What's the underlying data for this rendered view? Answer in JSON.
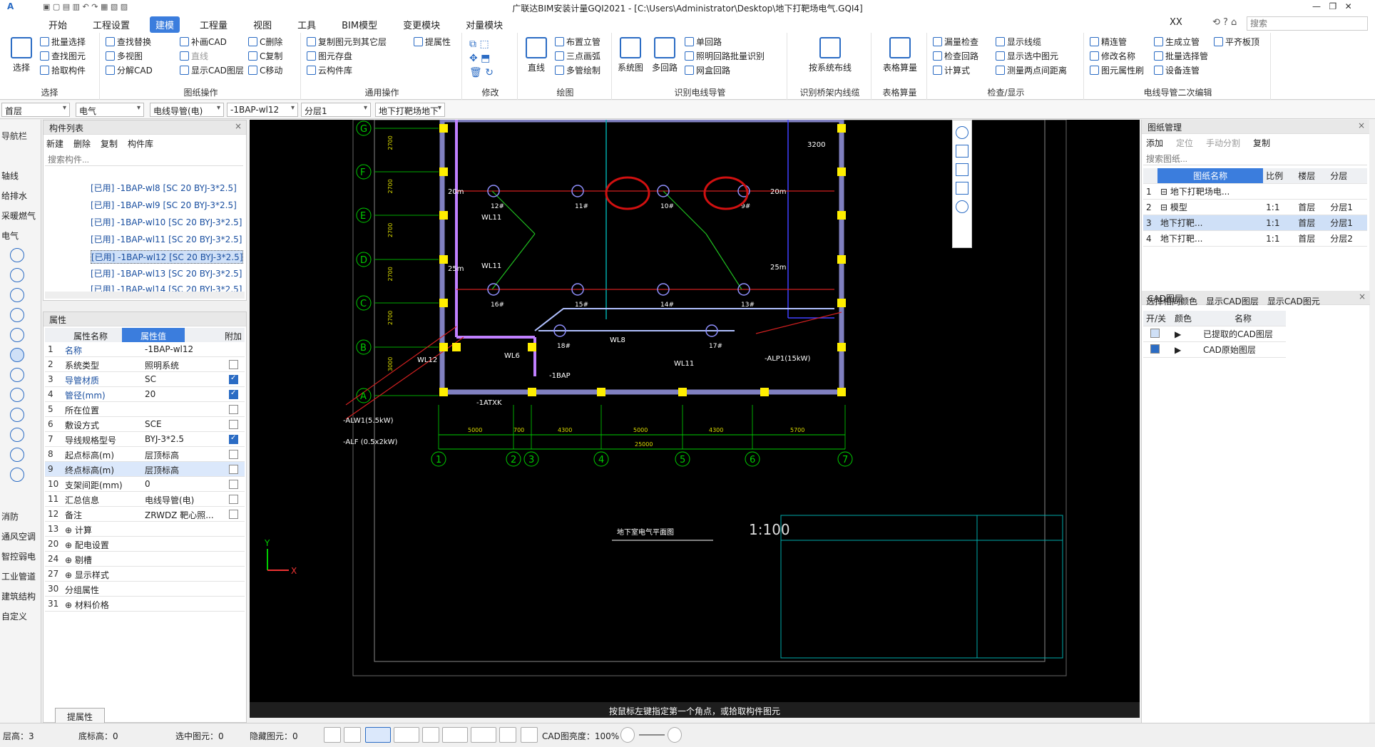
{
  "window": {
    "title": "广联达BIM安装计量GQI2021 - [C:\\Users\\Administrator\\Desktop\\地下打靶场电气.GQI4]",
    "user": "XX",
    "search_placeholder": "搜索"
  },
  "tabs": [
    "开始",
    "工程设置",
    "建模",
    "工程量",
    "视图",
    "工具",
    "BIM模型",
    "变更模块",
    "对量模块"
  ],
  "ribbon": {
    "select": {
      "big": "选择",
      "items": [
        "批量选择",
        "查找图元",
        "拾取构件"
      ],
      "label": "选择"
    },
    "drawing_ops": {
      "items": [
        "查找替换",
        "补画CAD",
        "C删除",
        "多视图",
        "直线",
        "C复制",
        "分解CAD",
        "显示CAD图层",
        "C移动"
      ],
      "label": "图纸操作"
    },
    "general_ops": {
      "items": [
        "复制图元到其它层",
        "提属性",
        "图元存盘",
        "云构件库"
      ],
      "label": "通用操作"
    },
    "modify": {
      "label": "修改"
    },
    "draw": {
      "big": "直线",
      "items": [
        "布置立管",
        "三点画弧",
        "多管绘制"
      ],
      "label": "绘图"
    },
    "recognize_pipe": {
      "big": [
        "系统图",
        "多回路"
      ],
      "items": [
        "单回路",
        "照明回路批量识别",
        "网盒回路"
      ],
      "label": "识别电线导管"
    },
    "recognize_bridge": {
      "big": "按系统布线",
      "label": "识别桥架内线缆"
    },
    "table_calc": {
      "big": "表格算量",
      "label": "表格算量"
    },
    "check": {
      "items": [
        "漏量检查",
        "显示线缆",
        "检查回路",
        "显示选中图元",
        "计算式",
        "测量两点间距离"
      ],
      "label": "检查/显示"
    },
    "secondary_edit": {
      "items": [
        "精连管",
        "生成立管",
        "平齐板顶",
        "修改名称",
        "批量选择管",
        "图元属性刷",
        "设备连管"
      ],
      "label": "电线导管二次编辑"
    }
  },
  "filters": [
    "首层",
    "电气",
    "电线导管(电)",
    "-1BAP-wl12",
    "分层1",
    "地下打靶场地下"
  ],
  "navbar": {
    "title": "导航栏",
    "items": [
      "轴线",
      "给排水",
      "采暖燃气",
      "电气",
      "消防",
      "通风空调",
      "智控弱电",
      "工业管道",
      "建筑结构",
      "自定义"
    ]
  },
  "component_list": {
    "title": "构件列表",
    "toolbar": [
      "新建",
      "删除",
      "复制",
      "构件库"
    ],
    "search_placeholder": "搜索构件...",
    "items": [
      "[已用] -1BAP-wl8 [SC 20 BYJ-3*2.5]",
      "[已用] -1BAP-wl9 [SC 20 BYJ-3*2.5]",
      "[已用] -1BAP-wl10 [SC 20 BYJ-3*2.5]",
      "[已用] -1BAP-wl11 [SC 20 BYJ-3*2.5]",
      "[已用] -1BAP-wl12 [SC 20 BYJ-3*2.5]",
      "[已用] -1BAP-wl13 [SC 20 BYJ-3*2.5]",
      "[已用] -1BAP-wl14 [SC 20 BYJ-3*2.5]"
    ],
    "selected_index": 4
  },
  "properties": {
    "title": "属性",
    "headers": [
      "属性名称",
      "属性值",
      "附加"
    ],
    "rows": [
      {
        "n": "1",
        "k": "名称",
        "v": "-1BAP-wl12",
        "c": null
      },
      {
        "n": "2",
        "k": "系统类型",
        "v": "照明系统",
        "c": false
      },
      {
        "n": "3",
        "k": "导管材质",
        "v": "SC",
        "c": true
      },
      {
        "n": "4",
        "k": "管径(mm)",
        "v": "20",
        "c": true
      },
      {
        "n": "5",
        "k": "所在位置",
        "v": "",
        "c": false
      },
      {
        "n": "6",
        "k": "敷设方式",
        "v": "SCE",
        "c": false
      },
      {
        "n": "7",
        "k": "导线规格型号",
        "v": "BYJ-3*2.5",
        "c": true
      },
      {
        "n": "8",
        "k": "起点标高(m)",
        "v": "层顶标高",
        "c": false
      },
      {
        "n": "9",
        "k": "终点标高(m)",
        "v": "层顶标高",
        "c": false
      },
      {
        "n": "10",
        "k": "支架间距(mm)",
        "v": "0",
        "c": false
      },
      {
        "n": "11",
        "k": "汇总信息",
        "v": "电线导管(电)",
        "c": false
      },
      {
        "n": "12",
        "k": "备注",
        "v": "ZRWDZ 靶心照...",
        "c": false
      },
      {
        "n": "13",
        "k": "⊕ 计算",
        "v": "",
        "c": null
      },
      {
        "n": "20",
        "k": "⊕ 配电设置",
        "v": "",
        "c": null
      },
      {
        "n": "24",
        "k": "⊕ 剔槽",
        "v": "",
        "c": null
      },
      {
        "n": "27",
        "k": "⊕ 显示样式",
        "v": "",
        "c": null
      },
      {
        "n": "30",
        "k": "分组属性",
        "v": "",
        "c": null
      },
      {
        "n": "31",
        "k": "⊕ 材料价格",
        "v": "",
        "c": null
      }
    ],
    "footer_button": "提属性"
  },
  "drawing": {
    "axis_rows": [
      "G",
      "F",
      "E",
      "D",
      "C",
      "B",
      "A"
    ],
    "axis_cols": [
      "1",
      "2",
      "3",
      "4",
      "5",
      "6",
      "7"
    ],
    "dims_bottom": [
      "5000",
      "700",
      "4300",
      "5000",
      "4300",
      "5700"
    ],
    "dim_total": "25000",
    "row_dims": [
      "2700",
      "2700",
      "2700",
      "2700",
      "2700",
      "3000"
    ],
    "labels": [
      "WL11",
      "WL11",
      "WL12",
      "WL6",
      "WL8",
      "WL11",
      "-1BAP",
      "-1ATXK",
      "-ALP1(15kW)",
      "-ALW1(5.5kW)",
      "-ALF (0.5x2kW)",
      "20m",
      "25m",
      "25m",
      "20m",
      "3200"
    ],
    "fixture_nums": [
      "12#",
      "11#",
      "10#",
      "9#",
      "16#",
      "15#",
      "14#",
      "13#",
      "18#",
      "17#"
    ],
    "scale": "1:100",
    "sheet_title": "地下室电气平面图",
    "hint": "按鼠标左键指定第一个角点，或拾取构件图元"
  },
  "drawing_mgmt": {
    "title": "图纸管理",
    "toolbar": [
      "添加",
      "定位",
      "手动分割",
      "复制"
    ],
    "search_placeholder": "搜索图纸...",
    "headers": [
      "图纸名称",
      "比例",
      "楼层",
      "分层"
    ],
    "rows": [
      {
        "n": "1",
        "name": "⊟ 地下打靶场电...",
        "scale": "",
        "floor": "",
        "layer": ""
      },
      {
        "n": "2",
        "name": "⊟ 模型",
        "scale": "1:1",
        "floor": "首层",
        "layer": "分层1"
      },
      {
        "n": "3",
        "name": "地下打靶...",
        "scale": "1:1",
        "floor": "首层",
        "layer": "分层1"
      },
      {
        "n": "4",
        "name": "地下打靶...",
        "scale": "1:1",
        "floor": "首层",
        "layer": "分层2"
      }
    ],
    "selected_index": 2
  },
  "cad_layers": {
    "title": "CAD图层",
    "toolbar": [
      "选择相同颜色",
      "显示CAD图层",
      "显示CAD图元"
    ],
    "headers": [
      "开/关",
      "颜色",
      "名称"
    ],
    "rows": [
      {
        "name": "已提取的CAD图层",
        "on": false
      },
      {
        "name": "CAD原始图层",
        "on": true
      }
    ]
  },
  "statusbar": {
    "floor_height": "层高：3",
    "base_elev": "底标高：0",
    "selected": "选中图元：0",
    "hidden": "隐藏图元：0",
    "cad_brightness": "CAD图亮度：100%"
  }
}
